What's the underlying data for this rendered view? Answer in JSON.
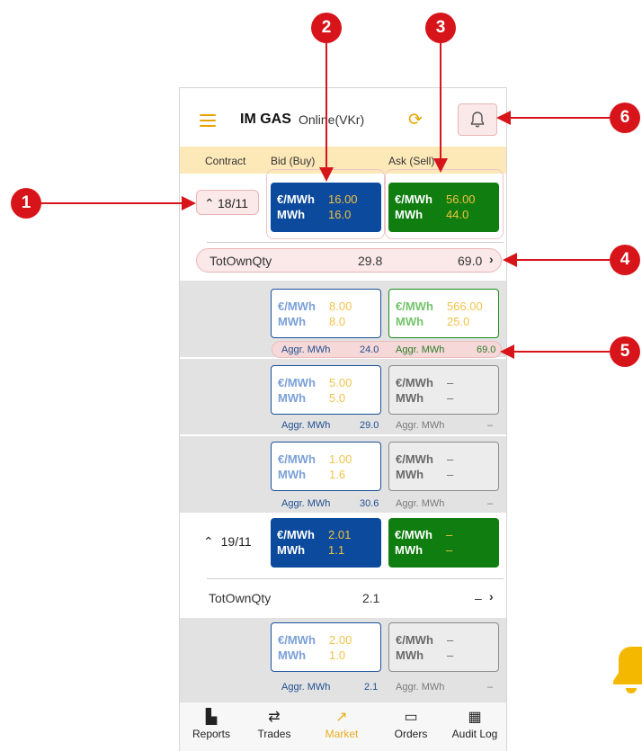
{
  "header": {
    "title": "IM GAS",
    "status": "Online(VKr)"
  },
  "columns": {
    "contract": "Contract",
    "bid": "Bid (Buy)",
    "ask": "Ask (Sell)"
  },
  "units": {
    "price": "€/MWh",
    "qty": "MWh",
    "aggr": "Aggr. MWh",
    "dash": "–"
  },
  "contract1": {
    "label": "18/11",
    "bid": {
      "price": "16.00",
      "qty": "16.0"
    },
    "ask": {
      "price": "56.00",
      "qty": "44.0"
    },
    "tot": {
      "label": "TotOwnQty",
      "bid": "29.8",
      "ask": "69.0"
    },
    "depth": [
      {
        "bid": {
          "price": "8.00",
          "qty": "8.0"
        },
        "ask": {
          "price": "566.00",
          "qty": "25.0"
        },
        "aggr_bid": "24.0",
        "aggr_ask": "69.0"
      },
      {
        "bid": {
          "price": "5.00",
          "qty": "5.0"
        },
        "ask": {
          "price": "–",
          "qty": "–"
        },
        "aggr_bid": "29.0",
        "aggr_ask": "–"
      },
      {
        "bid": {
          "price": "1.00",
          "qty": "1.6"
        },
        "ask": {
          "price": "–",
          "qty": "–"
        },
        "aggr_bid": "30.6",
        "aggr_ask": "–"
      }
    ]
  },
  "contract2": {
    "label": "19/11",
    "bid": {
      "price": "2.01",
      "qty": "1.1"
    },
    "ask": {
      "price": "–",
      "qty": "–"
    },
    "tot": {
      "label": "TotOwnQty",
      "bid": "2.1",
      "ask": "–"
    },
    "depth": [
      {
        "bid": {
          "price": "2.00",
          "qty": "1.0"
        },
        "ask": {
          "price": "–",
          "qty": "–"
        },
        "aggr_bid": "2.1",
        "aggr_ask": "–"
      }
    ]
  },
  "nav": {
    "reports": "Reports",
    "trades": "Trades",
    "market": "Market",
    "orders": "Orders",
    "audit": "Audit Log"
  },
  "callouts": [
    "1",
    "2",
    "3",
    "4",
    "5",
    "6"
  ],
  "colors": {
    "accent": "#e8a500",
    "bid": "#0b4a9c",
    "ask": "#0f7d10",
    "callout": "#d7141a"
  }
}
